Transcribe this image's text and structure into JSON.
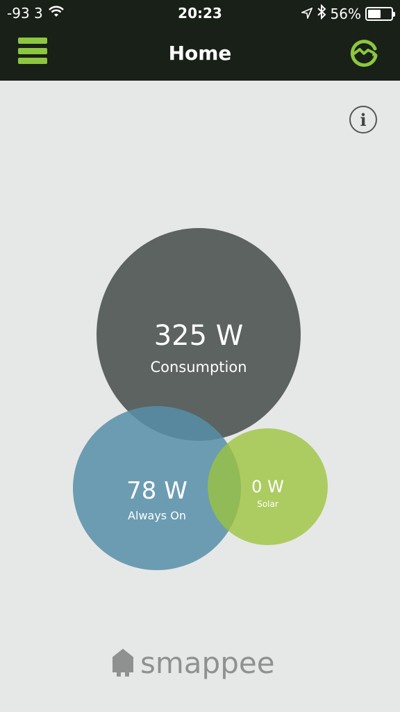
{
  "status_bar": {
    "signal": "-93 3",
    "time": "20:23",
    "battery_percent": "56%",
    "battery_level": 0.56,
    "icons": [
      "wifi-icon",
      "location-icon",
      "bluetooth-icon",
      "battery-icon"
    ]
  },
  "header": {
    "title": "Home",
    "menu_icon": "hamburger-icon",
    "sync_icon": "sync-icon"
  },
  "info": {
    "label": "i"
  },
  "bubbles": {
    "consumption": {
      "value": "325 W",
      "label": "Consumption",
      "color": "#5c6361"
    },
    "always_on": {
      "value": "78 W",
      "label": "Always On",
      "color": "#568ea8"
    },
    "solar": {
      "value": "0 W",
      "label": "Solar",
      "color": "#9bc43c"
    }
  },
  "footer": {
    "logo_text": "smappee"
  },
  "colors": {
    "accent": "#8dc63f",
    "header_bg": "#182018",
    "background": "#e6e8e7"
  }
}
